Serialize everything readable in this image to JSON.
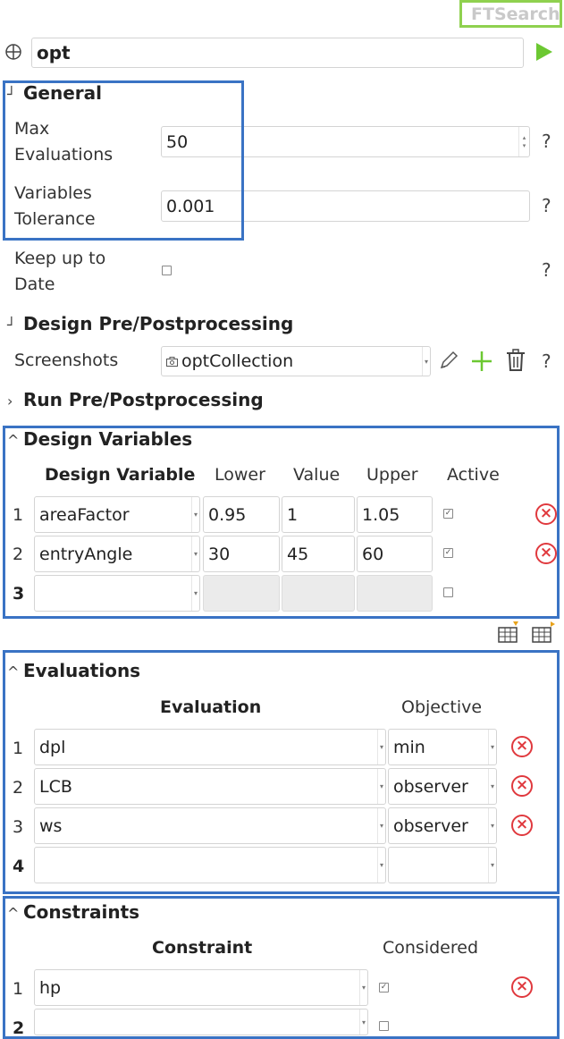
{
  "header": {
    "button_label": "FTSearch",
    "object_name": "opt",
    "object_icon": "crosshair-icon",
    "run_icon": "play-icon",
    "accent_color": "#8fd14f",
    "highlight_color": "#3a73c4"
  },
  "general": {
    "title": "General",
    "max_evaluations_label": "Max\nEvaluations",
    "max_evaluations_value": "50",
    "variables_tolerance_label": "Variables\nTolerance",
    "variables_tolerance_value": "0.001",
    "keep_up_to_date_label": "Keep up to\nDate",
    "keep_up_to_date_checked": false,
    "help": "?"
  },
  "design_prepost": {
    "title": "Design Pre/Postprocessing",
    "screenshots_label": "Screenshots",
    "screenshots_value": "optCollection",
    "help": "?"
  },
  "run_prepost": {
    "title": "Run Pre/Postprocessing"
  },
  "design_variables": {
    "title": "Design Variables",
    "columns": [
      "Design Variable",
      "Lower",
      "Value",
      "Upper",
      "Active"
    ],
    "rows": [
      {
        "num": "1",
        "name": "areaFactor",
        "lower": "0.95",
        "value": "1",
        "upper": "1.05",
        "active": true
      },
      {
        "num": "2",
        "name": "entryAngle",
        "lower": "30",
        "value": "45",
        "upper": "60",
        "active": true
      },
      {
        "num": "3",
        "name": "",
        "lower": "",
        "value": "",
        "upper": "",
        "active": false
      }
    ]
  },
  "evaluations": {
    "title": "Evaluations",
    "columns": [
      "Evaluation",
      "Objective"
    ],
    "rows": [
      {
        "num": "1",
        "name": "dpl",
        "objective": "min"
      },
      {
        "num": "2",
        "name": "LCB",
        "objective": "observer"
      },
      {
        "num": "3",
        "name": "ws",
        "objective": "observer"
      },
      {
        "num": "4",
        "name": "",
        "objective": ""
      }
    ]
  },
  "constraints": {
    "title": "Constraints",
    "columns": [
      "Constraint",
      "Considered"
    ],
    "rows": [
      {
        "num": "1",
        "name": "hp",
        "considered": true
      },
      {
        "num": "2",
        "name": "",
        "considered": false
      }
    ]
  }
}
